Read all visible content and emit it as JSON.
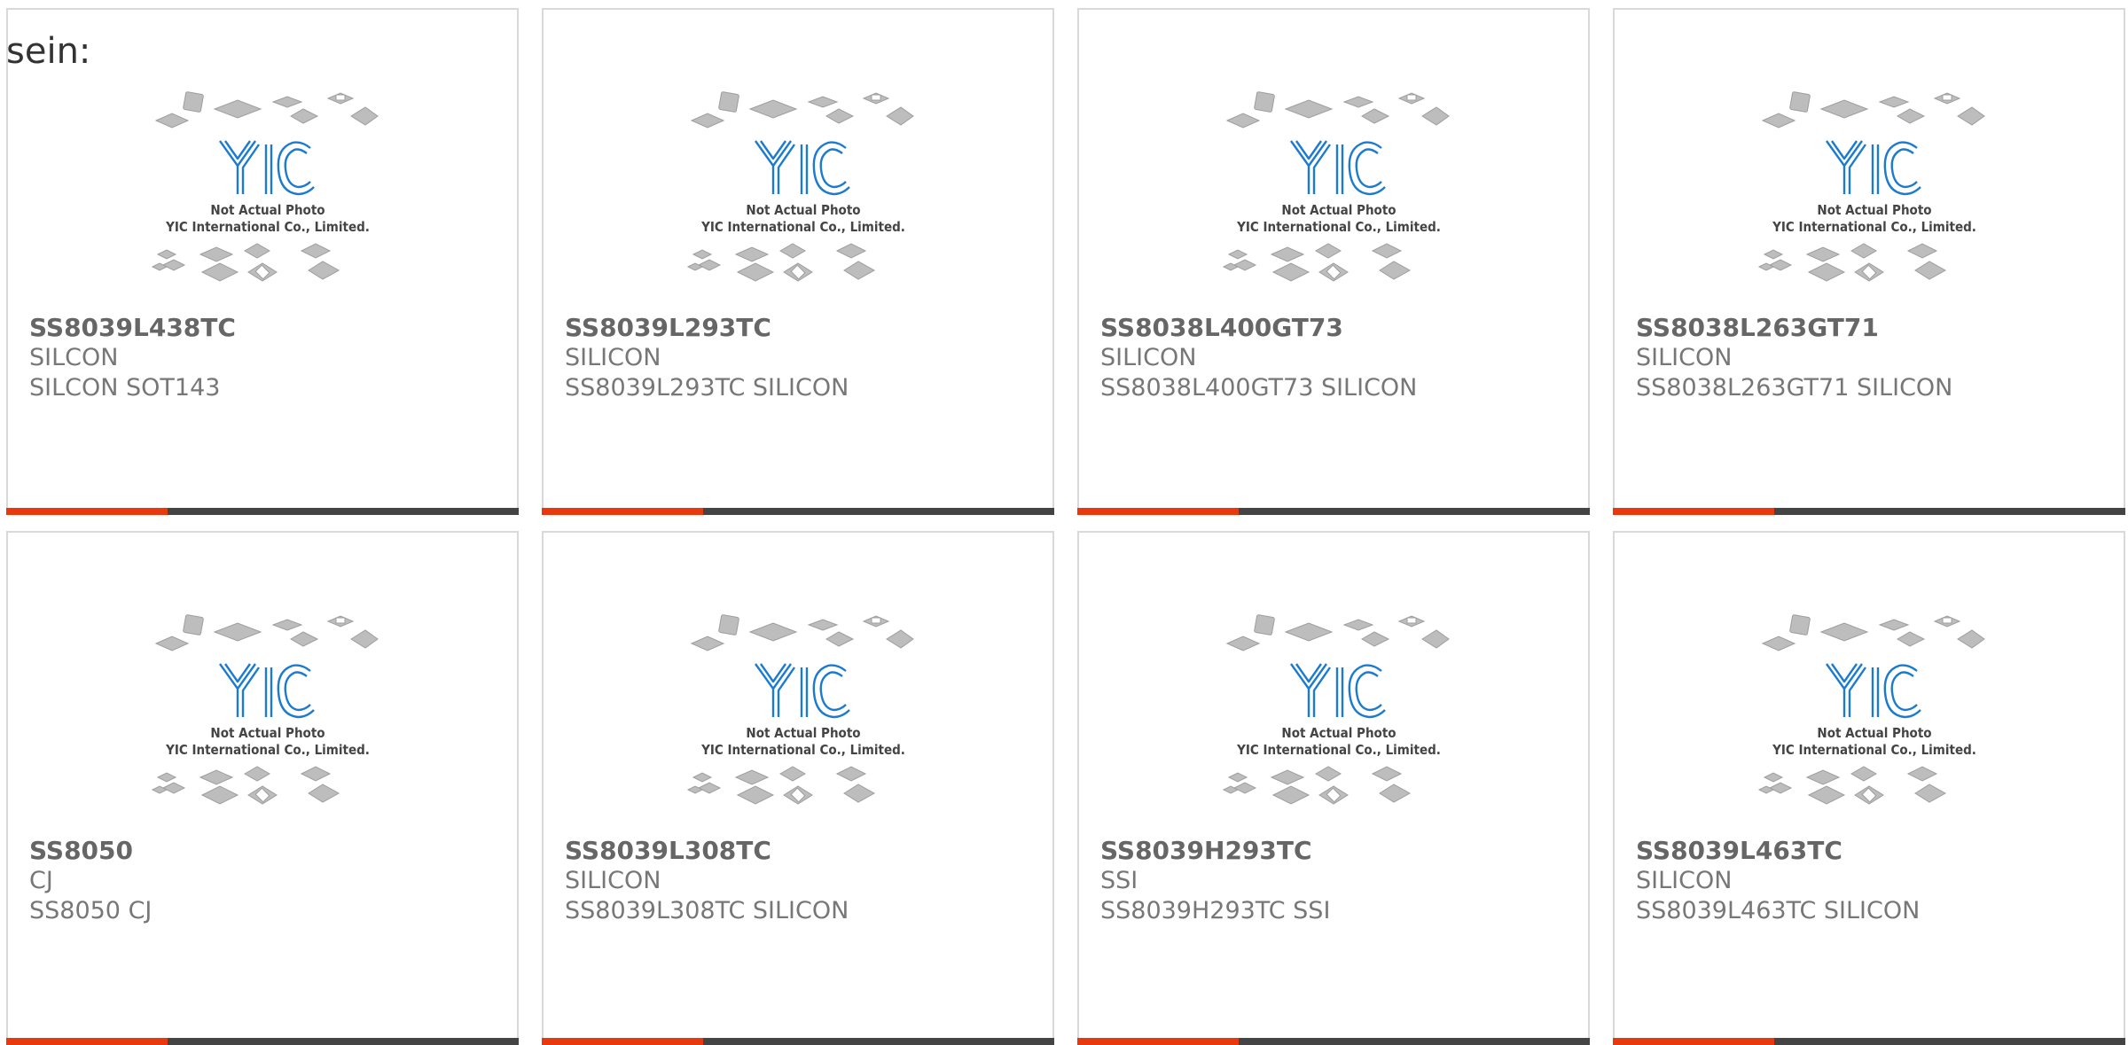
{
  "page": {
    "heading": "sein:"
  },
  "placeholder": {
    "line1": "Not Actual Photo",
    "line2": "YIC International Co., Limited.",
    "logo_text": "YIC"
  },
  "colors": {
    "accent": "#e8380d",
    "bar": "#444444",
    "logo": "#1a7bd1",
    "card_border": "#d9d9d9"
  },
  "products": [
    {
      "part": "SS8039L438TC",
      "manufacturer": "SILCON",
      "description": "SILCON SOT143"
    },
    {
      "part": "SS8039L293TC",
      "manufacturer": "SILICON",
      "description": "SS8039L293TC SILICON"
    },
    {
      "part": "SS8038L400GT73",
      "manufacturer": "SILICON",
      "description": "SS8038L400GT73 SILICON"
    },
    {
      "part": "SS8038L263GT71",
      "manufacturer": "SILICON",
      "description": "SS8038L263GT71 SILICON"
    },
    {
      "part": "SS8050",
      "manufacturer": "CJ",
      "description": "SS8050 CJ"
    },
    {
      "part": "SS8039L308TC",
      "manufacturer": "SILICON",
      "description": "SS8039L308TC SILICON"
    },
    {
      "part": "SS8039H293TC",
      "manufacturer": "SSI",
      "description": "SS8039H293TC SSI"
    },
    {
      "part": "SS8039L463TC",
      "manufacturer": "SILICON",
      "description": "SS8039L463TC SILICON"
    }
  ]
}
